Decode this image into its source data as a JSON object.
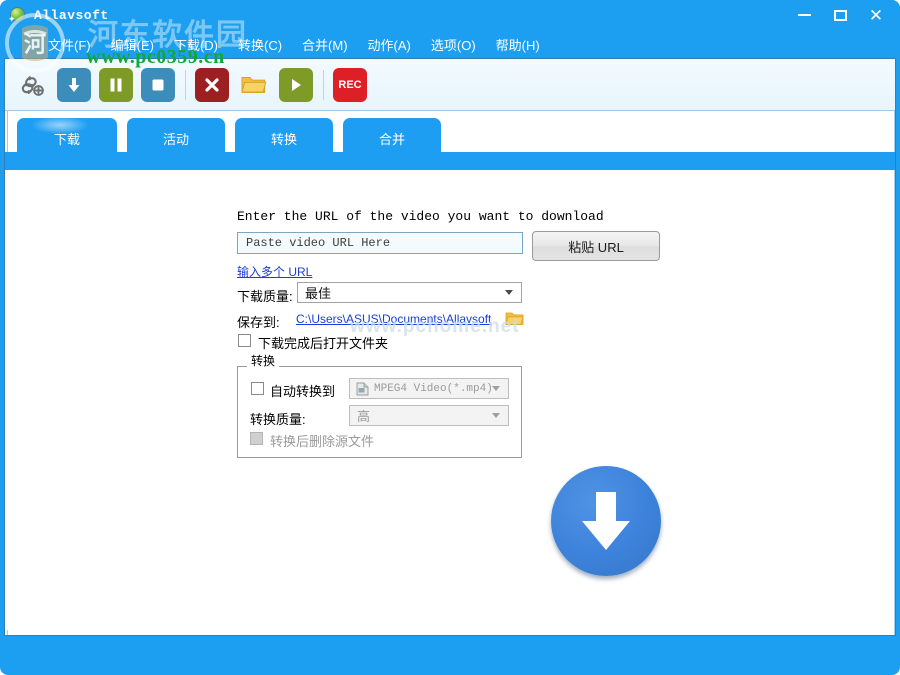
{
  "window": {
    "title": "Allavsoft",
    "icon": "globe-download-icon",
    "controls": {
      "minimize": "—",
      "maximize": "□",
      "close": "✕"
    }
  },
  "menubar": {
    "items": [
      {
        "label": "文件(F)",
        "name": "menu-file"
      },
      {
        "label": "编辑(E)",
        "name": "menu-edit"
      },
      {
        "label": "下载(D)",
        "name": "menu-download"
      },
      {
        "label": "转换(C)",
        "name": "menu-convert"
      },
      {
        "label": "合并(M)",
        "name": "menu-merge"
      },
      {
        "label": "动作(A)",
        "name": "menu-action"
      },
      {
        "label": "选项(O)",
        "name": "menu-options"
      },
      {
        "label": "帮助(H)",
        "name": "menu-help"
      }
    ]
  },
  "toolbar": {
    "buttons": [
      {
        "name": "add-url-button",
        "icon": "link-plus-icon",
        "color": "#6b6b6b"
      },
      {
        "name": "download-button",
        "icon": "download-arrow-icon",
        "color": "#3d8dba"
      },
      {
        "name": "pause-button",
        "icon": "pause-icon",
        "color": "#7f9b27"
      },
      {
        "name": "stop-button",
        "icon": "stop-square-icon",
        "color": "#3d8dba"
      },
      {
        "name": "delete-button",
        "icon": "close-x-icon",
        "color": "#9c1f22"
      },
      {
        "name": "open-folder-button",
        "icon": "folder-icon",
        "color": "#e8a825"
      },
      {
        "name": "play-button",
        "icon": "play-triangle-icon",
        "color": "#7f9b27"
      },
      {
        "name": "record-button",
        "icon": "rec-icon",
        "label": "REC",
        "color": "#de1f26"
      }
    ]
  },
  "tabs": [
    {
      "label": "下载",
      "name": "tab-download",
      "active": true
    },
    {
      "label": "活动",
      "name": "tab-activity",
      "active": false
    },
    {
      "label": "转换",
      "name": "tab-convert",
      "active": false
    },
    {
      "label": "合并",
      "name": "tab-merge",
      "active": false
    }
  ],
  "main": {
    "url_prompt": "Enter the URL of the video you want to download",
    "url_placeholder": "Paste video URL Here",
    "url_value": "",
    "paste_button": "粘贴 URL",
    "multi_url_link": "输入多个 URL",
    "quality_label": "下载质量:",
    "quality_value": "最佳",
    "saveto_label": "保存到:",
    "saveto_path": "C:\\Users\\ASUS\\Documents\\Allavsoft",
    "open_folder_checkbox": "下载完成后打开文件夹",
    "convert_group_title": "转换",
    "auto_convert_checkbox": "自动转换到",
    "format_value": "MPEG4 Video(*.mp4)",
    "convert_quality_label": "转换质量:",
    "convert_quality_value": "高",
    "delete_source_checkbox": "转换后删除源文件",
    "big_download_button": "download-circle-button"
  },
  "watermarks": {
    "site_cn": "河东软件园",
    "site_url": "www.pc0359.cn",
    "faint_url": "www.pchome.net"
  },
  "colors": {
    "titlebar": "#1c9ff0",
    "tab_active": "#1e9ef2",
    "accent_blue": "#3d82da",
    "link": "#1a3fd4",
    "watermark_green": "#13a63b"
  }
}
